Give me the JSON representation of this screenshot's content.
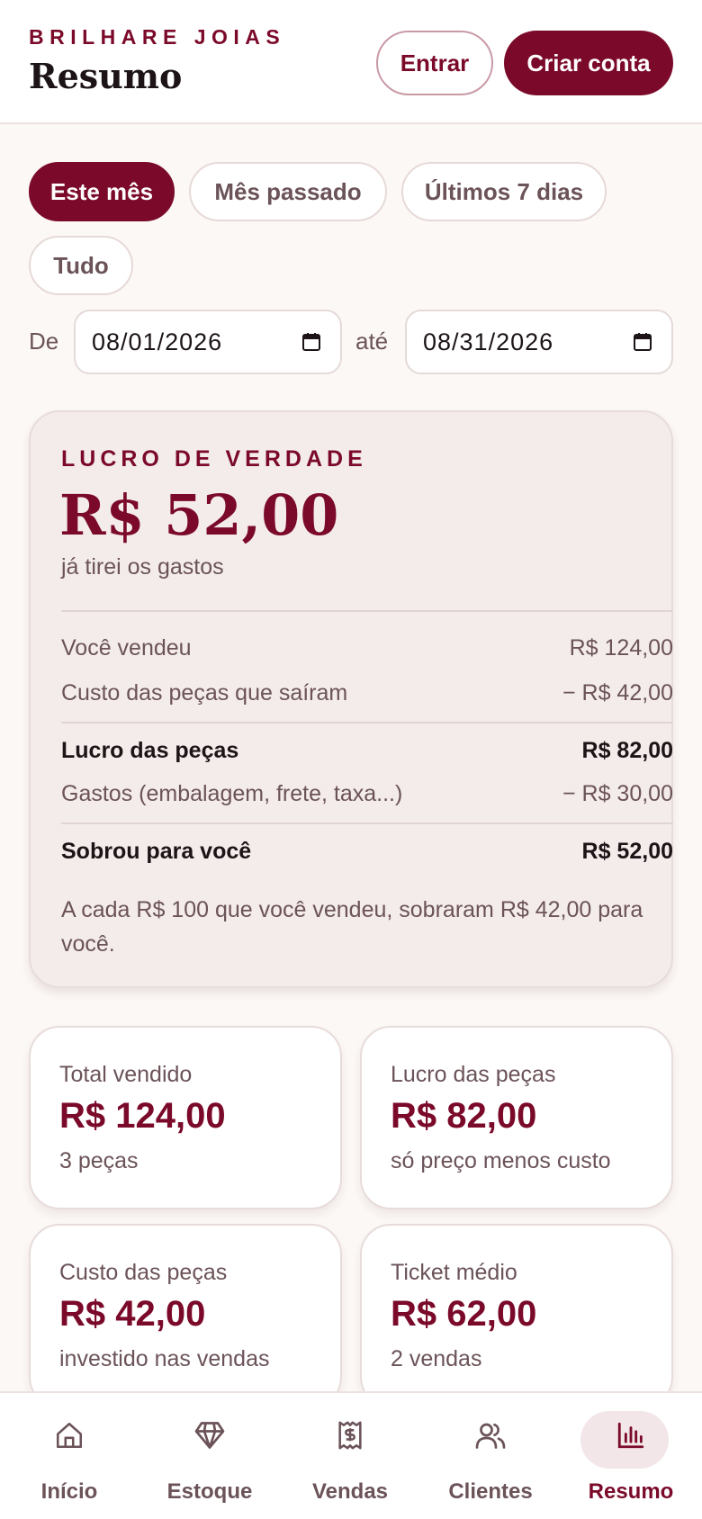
{
  "header": {
    "brand": "BRILHARE JOIAS",
    "title": "Resumo",
    "login_label": "Entrar",
    "signup_label": "Criar conta"
  },
  "filters": {
    "chips": [
      {
        "label": "Este mês",
        "active": true
      },
      {
        "label": "Mês passado",
        "active": false
      },
      {
        "label": "Últimos 7 dias",
        "active": false
      },
      {
        "label": "Tudo",
        "active": false
      }
    ],
    "from_label": "De",
    "from_value": "08/01/2026",
    "to_label": "até",
    "to_value": "08/31/2026"
  },
  "profit_card": {
    "label": "LUCRO DE VERDADE",
    "value": "R$ 52,00",
    "subtitle": "já tirei os gastos",
    "rows": [
      {
        "label": "Você vendeu",
        "value": "R$ 124,00"
      },
      {
        "label": "Custo das peças que saíram",
        "value": "− R$ 42,00"
      },
      {
        "label": "Lucro das peças",
        "value": "R$ 82,00"
      },
      {
        "label": "Gastos (embalagem, frete, taxa...)",
        "value": "− R$ 30,00"
      },
      {
        "label": "Sobrou para você",
        "value": "R$ 52,00"
      }
    ],
    "note": "A cada R$ 100 que você vendeu, sobraram R$ 42,00 para você."
  },
  "stats": [
    {
      "label": "Total vendido",
      "value": "R$ 124,00",
      "sub": "3 peças"
    },
    {
      "label": "Lucro das peças",
      "value": "R$ 82,00",
      "sub": "só preço menos custo"
    },
    {
      "label": "Custo das peças",
      "value": "R$ 42,00",
      "sub": "investido nas vendas"
    },
    {
      "label": "Ticket médio",
      "value": "R$ 62,00",
      "sub": "2 vendas"
    }
  ],
  "nav": [
    {
      "label": "Início",
      "icon": "home-icon",
      "active": false
    },
    {
      "label": "Estoque",
      "icon": "diamond-icon",
      "active": false
    },
    {
      "label": "Vendas",
      "icon": "receipt-icon",
      "active": false
    },
    {
      "label": "Clientes",
      "icon": "users-icon",
      "active": false
    },
    {
      "label": "Resumo",
      "icon": "bar-chart-icon",
      "active": true
    }
  ],
  "colors": {
    "accent": "#7b0a2a",
    "background": "#fcf8f6",
    "muted_text": "#6b5358"
  }
}
